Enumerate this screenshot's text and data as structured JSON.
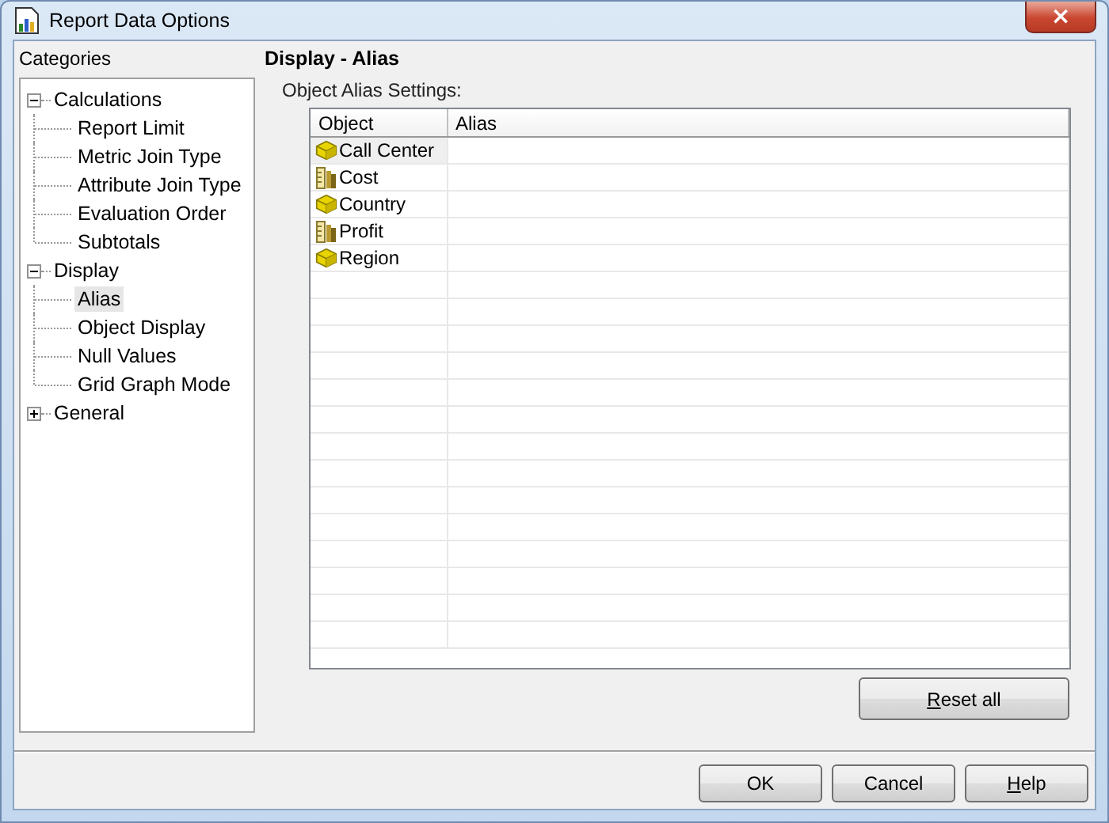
{
  "window": {
    "title": "Report Data Options",
    "close": "×"
  },
  "categories": {
    "label": "Categories",
    "tree": [
      {
        "label": "Calculations",
        "expanded": true,
        "selected": false,
        "children": [
          {
            "label": "Report Limit",
            "selected": false
          },
          {
            "label": "Metric Join Type",
            "selected": false
          },
          {
            "label": "Attribute Join Type",
            "selected": false
          },
          {
            "label": "Evaluation Order",
            "selected": false
          },
          {
            "label": "Subtotals",
            "selected": false
          }
        ]
      },
      {
        "label": "Display",
        "expanded": true,
        "selected": false,
        "children": [
          {
            "label": "Alias",
            "selected": true
          },
          {
            "label": "Object Display",
            "selected": false
          },
          {
            "label": "Null Values",
            "selected": false
          },
          {
            "label": "Grid Graph Mode",
            "selected": false
          }
        ]
      },
      {
        "label": "General",
        "expanded": false,
        "selected": false
      }
    ]
  },
  "panel": {
    "heading": "Display - Alias",
    "subheading": "Object Alias Settings:",
    "table": {
      "columns": [
        "Object",
        "Alias"
      ],
      "rows": [
        {
          "object": "Call Center",
          "kind": "attribute",
          "selected": true
        },
        {
          "object": "Cost",
          "kind": "metric",
          "selected": false
        },
        {
          "object": "Country",
          "kind": "attribute",
          "selected": false
        },
        {
          "object": "Profit",
          "kind": "metric",
          "selected": false
        },
        {
          "object": "Region",
          "kind": "attribute",
          "selected": false
        }
      ]
    },
    "reset_button": {
      "label": "Reset all",
      "mnemonic": true
    }
  },
  "buttons": [
    {
      "label": "OK",
      "mnemonic": false
    },
    {
      "label": "Cancel",
      "mnemonic": false
    },
    {
      "label": "Help",
      "mnemonic": true
    }
  ]
}
